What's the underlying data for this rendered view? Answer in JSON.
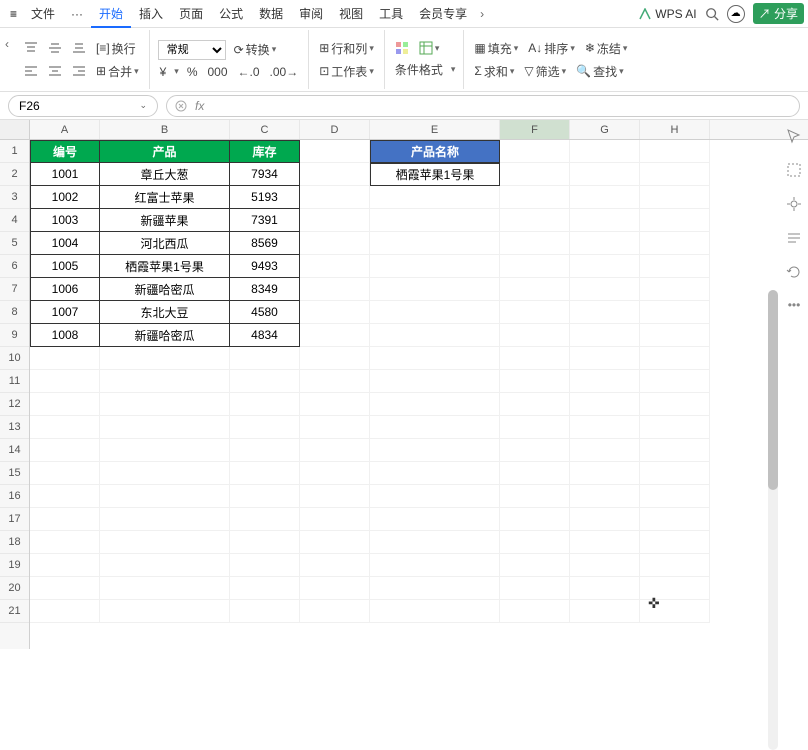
{
  "topbar": {
    "file": "文件",
    "more": "···",
    "tabs": [
      "开始",
      "插入",
      "页面",
      "公式",
      "数据",
      "审阅",
      "视图",
      "工具",
      "会员专享"
    ],
    "active_tab_index": 0,
    "ai_label": "WPS AI",
    "share": "分享"
  },
  "ribbon": {
    "wrap": "换行",
    "merge": "合并",
    "format": "常规",
    "convert": "转换",
    "currency": "¥",
    "percent": "%",
    "thousand": "000",
    "dec_inc": "+.0",
    "dec_dec": ".00",
    "row_col": "行和列",
    "worksheet": "工作表",
    "cond_fmt": "条件格式",
    "fill": "填充",
    "sum": "求和",
    "sort": "排序",
    "filter": "筛选",
    "freeze": "冻结",
    "find": "查找"
  },
  "namebox": "F26",
  "fx_symbol": "fx",
  "columns": [
    "A",
    "B",
    "C",
    "D",
    "E",
    "F",
    "G",
    "H"
  ],
  "rows_count": 21,
  "table_headers": {
    "id": "编号",
    "product": "产品",
    "stock": "库存"
  },
  "lookup_header": "产品名称",
  "lookup_value": "栖霞苹果1号果",
  "table_data": [
    {
      "id": "1001",
      "product": "章丘大葱",
      "stock": "7934"
    },
    {
      "id": "1002",
      "product": "红富士苹果",
      "stock": "5193"
    },
    {
      "id": "1003",
      "product": "新疆苹果",
      "stock": "7391"
    },
    {
      "id": "1004",
      "product": "河北西瓜",
      "stock": "8569"
    },
    {
      "id": "1005",
      "product": "栖霞苹果1号果",
      "stock": "9493"
    },
    {
      "id": "1006",
      "product": "新疆哈密瓜",
      "stock": "8349"
    },
    {
      "id": "1007",
      "product": "东北大豆",
      "stock": "4580"
    },
    {
      "id": "1008",
      "product": "新疆哈密瓜",
      "stock": "4834"
    }
  ],
  "selected_col": "F",
  "cursor_cell": {
    "row": 19,
    "col": "G"
  }
}
